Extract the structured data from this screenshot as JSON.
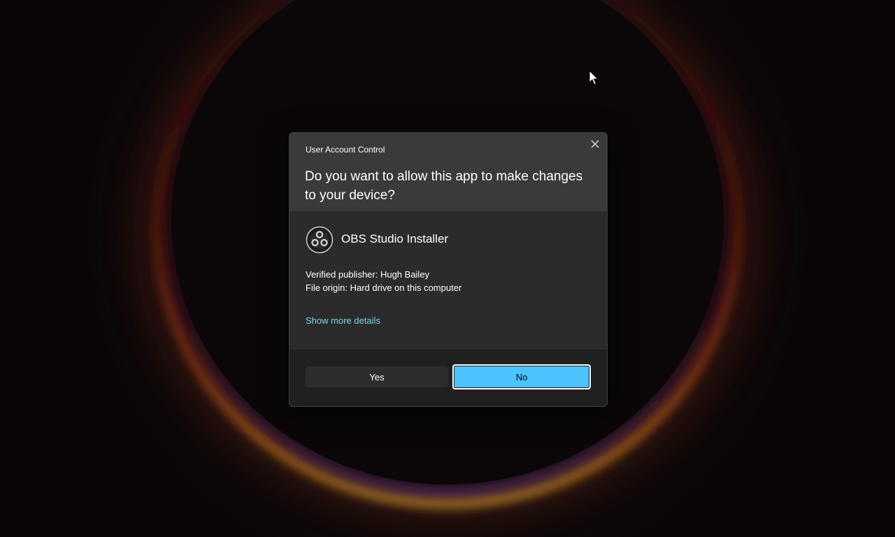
{
  "dialog": {
    "caption": "User Account Control",
    "question": "Do you want to allow this app to make changes to your device?",
    "close_icon": "close-icon",
    "app": {
      "icon": "obs-studio-icon",
      "name": "OBS Studio Installer"
    },
    "publisher_line": "Verified publisher: Hugh Bailey",
    "origin_line": "File origin: Hard drive on this computer",
    "details_link": "Show more details",
    "buttons": {
      "yes_label": "Yes",
      "no_label": "No"
    }
  },
  "colors": {
    "accent": "#4cc2ff",
    "link": "#7fd4e8",
    "dialog_header": "#3a3a3a",
    "dialog_body": "#2b2b2b",
    "dialog_footer": "#202020"
  },
  "desktop": {
    "cursor_icon": "mouse-pointer-icon"
  }
}
